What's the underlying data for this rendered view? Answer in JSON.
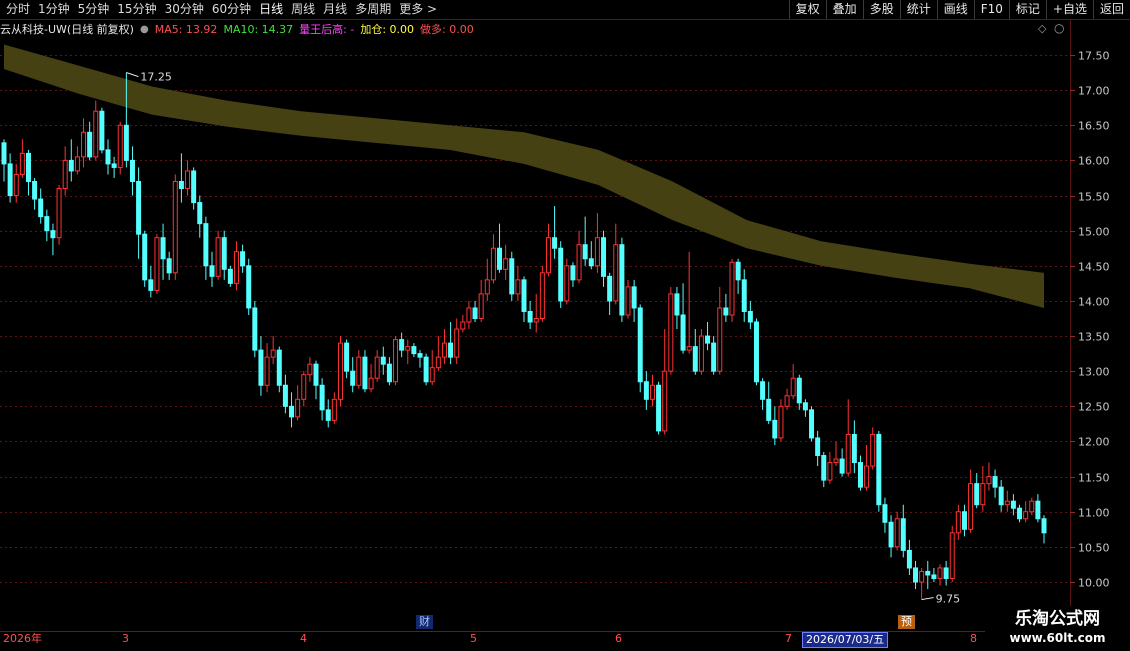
{
  "toolbar": {
    "periods": [
      "分时",
      "1分钟",
      "5分钟",
      "15分钟",
      "30分钟",
      "60分钟",
      "日线",
      "周线",
      "月线",
      "多周期",
      "更多 >"
    ],
    "tools": [
      "复权",
      "叠加",
      "多股",
      "统计",
      "画线",
      "F10",
      "标记",
      "+自选",
      "返回"
    ]
  },
  "info": {
    "stock": "云从科技-UW(日线 前复权)",
    "ma5": "MA5: 13.92",
    "ma10": "MA10: 14.37",
    "indicator": "量王后高: -",
    "jiacang": "加仓: 0.00",
    "zuoduo": "做多: 0.00"
  },
  "colors": {
    "up": "#ff3232",
    "down": "#54ffff",
    "band": "#4a4414",
    "grid": "#5a1414",
    "axis_text": "#c8c8c8",
    "ma5": "#ffffff",
    "ma10": "#ffff00",
    "indicator": "#ff00ff"
  },
  "chart_data": {
    "type": "candlestick",
    "y_ticks": [
      "17.50",
      "17.00",
      "16.50",
      "16.00",
      "15.50",
      "15.00",
      "14.50",
      "14.00",
      "13.50",
      "13.00",
      "12.50",
      "12.00",
      "11.50",
      "11.00",
      "10.50",
      "10.00"
    ],
    "ylim": [
      9.6,
      17.8
    ],
    "high_label": "17.25",
    "low_label": "9.75",
    "candles": [
      [
        16.25,
        15.95,
        16.3,
        15.7
      ],
      [
        15.95,
        15.5,
        16.1,
        15.4
      ],
      [
        15.5,
        15.8,
        15.95,
        15.4
      ],
      [
        15.8,
        16.1,
        16.3,
        15.75
      ],
      [
        16.1,
        15.7,
        16.15,
        15.5
      ],
      [
        15.7,
        15.45,
        15.75,
        15.3
      ],
      [
        15.45,
        15.2,
        15.6,
        15.1
      ],
      [
        15.2,
        15.0,
        15.3,
        14.85
      ],
      [
        15.0,
        14.9,
        15.1,
        14.65
      ],
      [
        14.9,
        15.6,
        15.65,
        14.8
      ],
      [
        15.6,
        16.0,
        16.2,
        15.5
      ],
      [
        16.0,
        15.85,
        16.3,
        15.7
      ],
      [
        15.85,
        16.05,
        16.2,
        15.8
      ],
      [
        16.05,
        16.4,
        16.6,
        15.9
      ],
      [
        16.4,
        16.05,
        16.55,
        16.0
      ],
      [
        16.05,
        16.7,
        16.85,
        16.0
      ],
      [
        16.7,
        16.15,
        16.75,
        16.1
      ],
      [
        16.15,
        15.95,
        16.3,
        15.8
      ],
      [
        15.95,
        15.9,
        16.05,
        15.75
      ],
      [
        15.9,
        16.5,
        16.55,
        15.8
      ],
      [
        16.5,
        16.0,
        17.25,
        15.9
      ],
      [
        16.0,
        15.7,
        16.2,
        15.5
      ],
      [
        15.7,
        14.95,
        15.9,
        14.6
      ],
      [
        14.95,
        14.3,
        15.0,
        14.2
      ],
      [
        14.3,
        14.15,
        14.5,
        14.05
      ],
      [
        14.15,
        14.9,
        14.95,
        14.1
      ],
      [
        14.9,
        14.6,
        15.1,
        14.3
      ],
      [
        14.6,
        14.4,
        14.7,
        14.3
      ],
      [
        14.4,
        15.7,
        15.8,
        14.3
      ],
      [
        15.7,
        15.6,
        16.1,
        15.4
      ],
      [
        15.6,
        15.85,
        16.0,
        15.5
      ],
      [
        15.85,
        15.4,
        15.9,
        15.3
      ],
      [
        15.4,
        15.1,
        15.5,
        14.9
      ],
      [
        15.1,
        14.5,
        15.2,
        14.3
      ],
      [
        14.5,
        14.35,
        14.7,
        14.2
      ],
      [
        14.35,
        14.9,
        15.0,
        14.3
      ],
      [
        14.9,
        14.45,
        15.0,
        14.3
      ],
      [
        14.45,
        14.25,
        14.5,
        14.2
      ],
      [
        14.25,
        14.7,
        14.85,
        14.15
      ],
      [
        14.7,
        14.5,
        14.8,
        14.4
      ],
      [
        14.5,
        13.9,
        14.6,
        13.8
      ],
      [
        13.9,
        13.3,
        14.0,
        13.2
      ],
      [
        13.3,
        12.8,
        13.5,
        12.65
      ],
      [
        12.8,
        13.2,
        13.4,
        12.7
      ],
      [
        13.2,
        13.3,
        13.5,
        13.1
      ],
      [
        13.3,
        12.8,
        13.35,
        12.7
      ],
      [
        12.8,
        12.5,
        12.95,
        12.4
      ],
      [
        12.5,
        12.35,
        12.7,
        12.2
      ],
      [
        12.35,
        12.6,
        12.8,
        12.3
      ],
      [
        12.6,
        12.95,
        13.0,
        12.5
      ],
      [
        12.95,
        13.1,
        13.2,
        12.85
      ],
      [
        13.1,
        12.8,
        13.15,
        12.6
      ],
      [
        12.8,
        12.45,
        12.9,
        12.3
      ],
      [
        12.45,
        12.3,
        12.6,
        12.2
      ],
      [
        12.3,
        12.6,
        12.7,
        12.25
      ],
      [
        12.6,
        13.4,
        13.5,
        12.5
      ],
      [
        13.4,
        13.0,
        13.45,
        12.9
      ],
      [
        13.0,
        12.8,
        13.2,
        12.7
      ],
      [
        12.8,
        13.2,
        13.3,
        12.75
      ],
      [
        13.2,
        12.75,
        13.3,
        12.7
      ],
      [
        12.75,
        12.9,
        13.1,
        12.7
      ],
      [
        12.9,
        13.2,
        13.3,
        12.85
      ],
      [
        13.2,
        13.1,
        13.35,
        12.95
      ],
      [
        13.1,
        12.85,
        13.2,
        12.8
      ],
      [
        12.85,
        13.45,
        13.5,
        12.8
      ],
      [
        13.45,
        13.3,
        13.55,
        13.2
      ],
      [
        13.3,
        13.35,
        13.45,
        13.1
      ],
      [
        13.35,
        13.25,
        13.4,
        13.2
      ],
      [
        13.25,
        13.2,
        13.3,
        13.05
      ],
      [
        13.2,
        12.85,
        13.25,
        12.8
      ],
      [
        12.85,
        13.05,
        13.3,
        12.8
      ],
      [
        13.05,
        13.2,
        13.5,
        13.0
      ],
      [
        13.2,
        13.4,
        13.6,
        13.1
      ],
      [
        13.4,
        13.2,
        13.7,
        13.1
      ],
      [
        13.2,
        13.6,
        13.75,
        13.1
      ],
      [
        13.6,
        13.7,
        13.8,
        13.55
      ],
      [
        13.7,
        13.9,
        14.0,
        13.6
      ],
      [
        13.9,
        13.75,
        14.0,
        13.7
      ],
      [
        13.75,
        14.1,
        14.3,
        13.7
      ],
      [
        14.1,
        14.3,
        14.6,
        14.0
      ],
      [
        14.3,
        14.75,
        14.95,
        14.25
      ],
      [
        14.75,
        14.45,
        15.1,
        14.4
      ],
      [
        14.45,
        14.6,
        14.8,
        14.3
      ],
      [
        14.6,
        14.1,
        14.7,
        14.0
      ],
      [
        14.1,
        14.3,
        14.5,
        14.0
      ],
      [
        14.3,
        13.85,
        14.35,
        13.7
      ],
      [
        13.85,
        13.7,
        14.0,
        13.6
      ],
      [
        13.7,
        13.75,
        14.1,
        13.55
      ],
      [
        13.75,
        14.4,
        14.5,
        13.7
      ],
      [
        14.4,
        14.9,
        15.1,
        14.35
      ],
      [
        14.9,
        14.75,
        15.35,
        14.6
      ],
      [
        14.75,
        14.0,
        14.85,
        13.9
      ],
      [
        14.0,
        14.5,
        14.6,
        13.95
      ],
      [
        14.5,
        14.3,
        14.55,
        14.2
      ],
      [
        14.3,
        14.8,
        15.0,
        14.25
      ],
      [
        14.8,
        14.6,
        15.2,
        14.5
      ],
      [
        14.6,
        14.5,
        14.85,
        14.45
      ],
      [
        14.5,
        14.9,
        15.25,
        14.4
      ],
      [
        14.9,
        14.35,
        15.0,
        14.2
      ],
      [
        14.35,
        14.0,
        14.4,
        13.8
      ],
      [
        14.0,
        14.8,
        15.1,
        13.95
      ],
      [
        14.8,
        13.8,
        14.9,
        13.7
      ],
      [
        13.8,
        14.2,
        14.3,
        13.75
      ],
      [
        14.2,
        13.9,
        14.3,
        13.7
      ],
      [
        13.9,
        12.85,
        13.95,
        12.7
      ],
      [
        12.85,
        12.6,
        13.0,
        12.45
      ],
      [
        12.6,
        12.8,
        12.95,
        12.5
      ],
      [
        12.8,
        12.15,
        12.85,
        12.1
      ],
      [
        12.15,
        13.0,
        13.6,
        12.1
      ],
      [
        13.0,
        14.1,
        14.2,
        12.95
      ],
      [
        14.1,
        13.8,
        14.2,
        13.6
      ],
      [
        13.8,
        13.3,
        14.25,
        13.25
      ],
      [
        13.3,
        13.35,
        14.7,
        13.25
      ],
      [
        13.35,
        13.0,
        13.6,
        12.95
      ],
      [
        13.0,
        13.5,
        13.6,
        12.95
      ],
      [
        13.5,
        13.4,
        13.7,
        13.3
      ],
      [
        13.4,
        13.0,
        13.5,
        12.95
      ],
      [
        13.0,
        13.9,
        14.2,
        12.95
      ],
      [
        13.9,
        13.8,
        14.1,
        13.7
      ],
      [
        13.8,
        14.55,
        14.6,
        13.7
      ],
      [
        14.55,
        14.3,
        14.6,
        14.1
      ],
      [
        14.3,
        13.85,
        14.45,
        13.7
      ],
      [
        13.85,
        13.7,
        14.0,
        13.6
      ],
      [
        13.7,
        12.85,
        13.75,
        12.8
      ],
      [
        12.85,
        12.6,
        12.9,
        12.45
      ],
      [
        12.6,
        12.3,
        12.85,
        12.25
      ],
      [
        12.3,
        12.05,
        12.5,
        11.95
      ],
      [
        12.05,
        12.5,
        12.6,
        12.0
      ],
      [
        12.5,
        12.65,
        12.75,
        12.45
      ],
      [
        12.65,
        12.9,
        13.1,
        12.6
      ],
      [
        12.9,
        12.55,
        12.95,
        12.45
      ],
      [
        12.55,
        12.45,
        12.6,
        12.35
      ],
      [
        12.45,
        12.05,
        12.5,
        12.0
      ],
      [
        12.05,
        11.8,
        12.15,
        11.65
      ],
      [
        11.8,
        11.45,
        11.85,
        11.35
      ],
      [
        11.45,
        11.7,
        11.85,
        11.4
      ],
      [
        11.7,
        11.75,
        12.0,
        11.65
      ],
      [
        11.75,
        11.55,
        11.9,
        11.5
      ],
      [
        11.55,
        12.1,
        12.6,
        11.5
      ],
      [
        12.1,
        11.7,
        12.3,
        11.55
      ],
      [
        11.7,
        11.35,
        11.8,
        11.3
      ],
      [
        11.35,
        11.65,
        11.95,
        11.3
      ],
      [
        11.65,
        12.1,
        12.2,
        11.6
      ],
      [
        12.1,
        11.1,
        12.15,
        11.0
      ],
      [
        11.1,
        10.85,
        11.2,
        10.7
      ],
      [
        10.85,
        10.5,
        10.95,
        10.35
      ],
      [
        10.5,
        10.9,
        11.0,
        10.45
      ],
      [
        10.9,
        10.45,
        11.1,
        10.35
      ],
      [
        10.45,
        10.2,
        10.6,
        10.1
      ],
      [
        10.2,
        10.0,
        10.3,
        9.9
      ],
      [
        10.0,
        10.15,
        10.2,
        9.75
      ],
      [
        10.15,
        10.1,
        10.3,
        9.9
      ],
      [
        10.1,
        10.05,
        10.2,
        10.0
      ],
      [
        10.05,
        10.2,
        10.25,
        9.95
      ],
      [
        10.2,
        10.05,
        10.3,
        9.95
      ],
      [
        10.05,
        10.7,
        10.8,
        10.0
      ],
      [
        10.7,
        11.0,
        11.1,
        10.6
      ],
      [
        11.0,
        10.75,
        11.1,
        10.65
      ],
      [
        10.75,
        11.4,
        11.6,
        10.7
      ],
      [
        11.4,
        11.1,
        11.55,
        11.05
      ],
      [
        11.1,
        11.4,
        11.65,
        11.0
      ],
      [
        11.4,
        11.5,
        11.7,
        11.3
      ],
      [
        11.5,
        11.35,
        11.6,
        11.2
      ],
      [
        11.35,
        11.1,
        11.45,
        11.0
      ],
      [
        11.1,
        11.15,
        11.3,
        11.0
      ],
      [
        11.15,
        11.05,
        11.25,
        10.95
      ],
      [
        11.05,
        10.9,
        11.1,
        10.85
      ],
      [
        10.9,
        11.0,
        11.15,
        10.85
      ],
      [
        11.0,
        11.15,
        11.2,
        10.95
      ],
      [
        11.15,
        10.9,
        11.25,
        10.85
      ],
      [
        10.9,
        10.7,
        10.95,
        10.55
      ]
    ],
    "band": {
      "upper": [
        17.65,
        17.35,
        17.05,
        16.85,
        16.7,
        16.6,
        16.5,
        16.4,
        16.15,
        15.7,
        15.15,
        14.85,
        14.68,
        14.53,
        14.4
      ],
      "lower": [
        17.3,
        16.95,
        16.65,
        16.48,
        16.35,
        16.25,
        16.15,
        15.95,
        15.65,
        15.15,
        14.75,
        14.5,
        14.33,
        14.18,
        13.9
      ]
    },
    "x_labels": [
      "2026年",
      "3",
      "4",
      "5",
      "6",
      "7",
      "8"
    ],
    "date_badge": "2026/07/03/五",
    "event_badges": [
      "财",
      "预"
    ]
  },
  "watermark": {
    "line1": "乐淘公式网",
    "line2": "www.60lt.com"
  }
}
